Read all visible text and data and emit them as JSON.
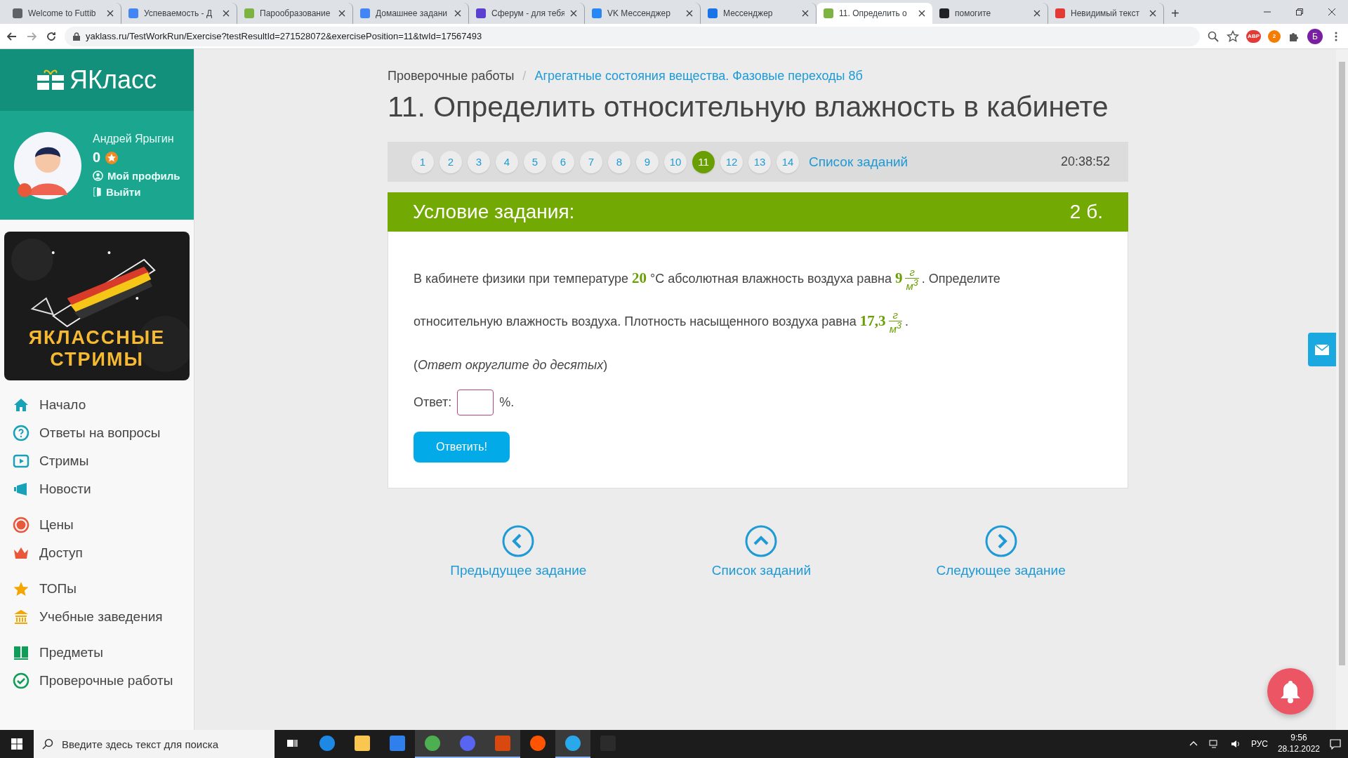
{
  "browser": {
    "tabs": [
      {
        "label": "Welcome to Futtib",
        "selected": false,
        "color": "#5f6368"
      },
      {
        "label": "Успеваемость - Д",
        "selected": false,
        "color": "#4285f4"
      },
      {
        "label": "Парообразование",
        "selected": false,
        "color": "#7cb342"
      },
      {
        "label": "Домашнее задани",
        "selected": false,
        "color": "#4285f4"
      },
      {
        "label": "Сферум - для тебя",
        "selected": false,
        "color": "#5b3fd1"
      },
      {
        "label": "VK Мессенджер",
        "selected": false,
        "color": "#2787f5"
      },
      {
        "label": "Мессенджер",
        "selected": false,
        "color": "#1a73e8"
      },
      {
        "label": "11. Определить о",
        "selected": true,
        "color": "#7cb342"
      },
      {
        "label": "помогите",
        "selected": false,
        "color": "#202124"
      },
      {
        "label": "Невидимый текст",
        "selected": false,
        "color": "#e53935"
      }
    ],
    "new_tab": "+",
    "url": "yaklass.ru/TestWorkRun/Exercise?testResultId=271528072&exercisePosition=11&twId=17567493",
    "extensions": [
      {
        "label": "ABP",
        "color": "#e53935"
      },
      {
        "label": "2",
        "color": "#f57c00"
      }
    ],
    "profile": "Б"
  },
  "sidebar": {
    "logo": "ЯКласс",
    "user": {
      "name": "Андрей Ярыгин",
      "points": "0",
      "links": [
        {
          "kind": "profile",
          "label": "Мой профиль"
        },
        {
          "kind": "logout",
          "label": "Выйти"
        }
      ]
    },
    "banner": {
      "lines": [
        "ЯКЛАССНЫЕ",
        "СТРИМЫ"
      ]
    },
    "menu": [
      [
        {
          "label": "Начало"
        },
        {
          "label": "Ответы на вопросы"
        },
        {
          "label": "Стримы"
        },
        {
          "label": "Новости"
        }
      ],
      [
        {
          "label": "Цены"
        },
        {
          "label": "Доступ"
        }
      ],
      [
        {
          "label": "ТОПы"
        },
        {
          "label": "Учебные заведения"
        }
      ],
      [
        {
          "label": "Предметы"
        },
        {
          "label": "Проверочные работы"
        }
      ]
    ]
  },
  "breadcrumb": [
    {
      "label": "Проверочные работы",
      "link": false
    },
    {
      "label": "/",
      "kind": "separator"
    },
    {
      "label": "Агрегатные состояния вещества. Фазовые переходы 8б",
      "link": true
    }
  ],
  "title": "11. Определить относительную влажность в кабинете",
  "pager": {
    "pages": [
      {
        "label": "1",
        "selected": false
      },
      {
        "label": "2",
        "selected": false
      },
      {
        "label": "3",
        "selected": false
      },
      {
        "label": "4",
        "selected": false
      },
      {
        "label": "5",
        "selected": false
      },
      {
        "label": "6",
        "selected": false
      },
      {
        "label": "7",
        "selected": false
      },
      {
        "label": "8",
        "selected": false
      },
      {
        "label": "9",
        "selected": false
      },
      {
        "label": "10",
        "selected": false
      },
      {
        "label": "11",
        "selected": true
      },
      {
        "label": "12",
        "selected": false
      },
      {
        "label": "13",
        "selected": false
      },
      {
        "label": "14",
        "selected": false
      }
    ],
    "list_link": "Список заданий",
    "timer": "20:38:52"
  },
  "task": {
    "header": "Условие задания:",
    "points": "2 б.",
    "problem": [
      {
        "kind": "text",
        "text": "В кабинете физики при температуре "
      },
      {
        "kind": "number",
        "text": "20"
      },
      {
        "kind": "text",
        "text": " °C абсолютная влажность воздуха равна "
      },
      {
        "kind": "number",
        "text": "9"
      },
      {
        "kind": "fraction",
        "numerator": "г",
        "denominator": "м$^{3}$"
      },
      {
        "kind": "text",
        "text": ". Определите"
      },
      {
        "kind": "break"
      },
      {
        "kind": "text",
        "text": "относительную влажность воздуха. Плотность насыщенного воздуха равна "
      },
      {
        "kind": "number",
        "text": "17,3"
      },
      {
        "kind": "fraction",
        "numerator": "г",
        "denominator": "м$^{3}$"
      },
      {
        "kind": "text",
        "text": "."
      }
    ],
    "note": "(*Ответ округлите до десятых*)",
    "answer_label": "Ответ:",
    "answer_unit": "%.",
    "submit": "Ответить!"
  },
  "nav": [
    {
      "kind": "prev",
      "label": "Предыдущее задание"
    },
    {
      "kind": "list",
      "label": "Список заданий"
    },
    {
      "kind": "next",
      "label": "Следующее задание"
    }
  ],
  "taskbar": {
    "search_placeholder": "Введите здесь текст для поиска",
    "apps": [
      {
        "kind": "taskview",
        "color": "#ffffff",
        "selected": false
      },
      {
        "kind": "edge",
        "color": "#1e88e5",
        "selected": false
      },
      {
        "kind": "folder",
        "color": "#f9c74f",
        "selected": false
      },
      {
        "kind": "store",
        "color": "#2f80ed",
        "selected": false
      },
      {
        "kind": "chrome",
        "color": "#4caf50",
        "selected": true
      },
      {
        "kind": "discord",
        "color": "#5865f2",
        "selected": true
      },
      {
        "kind": "p",
        "color": "#d9480f",
        "selected": true
      },
      {
        "kind": "cloud",
        "color": "#ff5500",
        "selected": false
      },
      {
        "kind": "telegram",
        "color": "#29a9eb",
        "selected": true
      },
      {
        "kind": "epic",
        "color": "#2b2b2b",
        "selected": false
      }
    ],
    "language": "РУС",
    "time": "9:56",
    "date": "28.12.2022"
  }
}
